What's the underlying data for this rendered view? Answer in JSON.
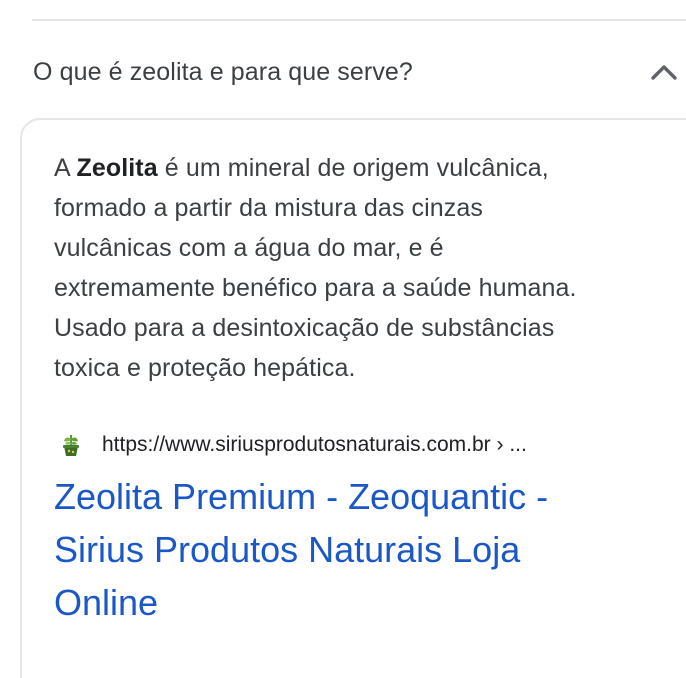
{
  "faq": {
    "question": "O que é zeolita e para que serve?",
    "expanded_icon": "chevron-up-icon",
    "answer": {
      "line1_prefix": "A ",
      "line1_bold": "Zeolita",
      "line1_suffix": " é um mineral de origem vulcânica,",
      "line2": "formado a partir da mistura das cinzas",
      "line3": "vulcânicas com a água do mar, e é",
      "line4": "extremamente benéfico para a saúde humana.",
      "line5": "Usado para a desintoxicação de substâncias",
      "line6": "toxica e proteção hepática."
    },
    "source": {
      "favicon": "plant-favicon-icon",
      "url": "https://www.siriusprodutosnaturais.com.br › ..."
    },
    "result_title": {
      "line1": "Zeolita Premium - Zeoquantic -",
      "line2": "Sirius Produtos Naturais Loja",
      "line3": "Online"
    }
  },
  "colors": {
    "text": "#3c4043",
    "link": "#1a57c7",
    "divider": "#e3e3e3"
  }
}
